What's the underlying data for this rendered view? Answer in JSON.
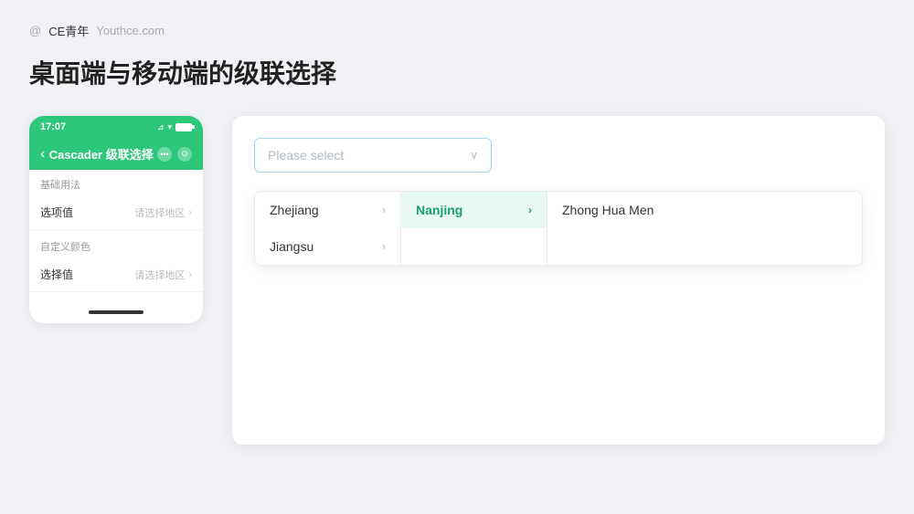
{
  "brand": {
    "at_symbol": "@",
    "name": "CE青年",
    "url": "Youthce.com"
  },
  "page_title": "桌面端与移动端的级联选择",
  "mobile": {
    "status_bar": {
      "time": "17:07",
      "signal": "⊿",
      "wifi": "▾"
    },
    "nav": {
      "back_icon": "‹",
      "title": "Cascader 级联选择",
      "action1": "•••",
      "action2": "⊙"
    },
    "section1_label": "基础用法",
    "items": [
      {
        "label": "选项值",
        "value": "请选择地区"
      },
      {
        "label": "选择值",
        "value": "请选择地区"
      }
    ],
    "section2_label": "自定义颜色",
    "home_indicator": ""
  },
  "desktop": {
    "input": {
      "placeholder": "Please select",
      "arrow": "∨"
    },
    "columns": [
      {
        "items": [
          {
            "label": "Zhejiang",
            "has_arrow": true,
            "active": false
          },
          {
            "label": "Jiangsu",
            "has_arrow": true,
            "active": false
          }
        ]
      },
      {
        "items": [
          {
            "label": "Nanjing",
            "has_arrow": true,
            "active": true
          }
        ]
      },
      {
        "items": [
          {
            "label": "Zhong Hua Men",
            "has_arrow": false,
            "active": false
          }
        ]
      }
    ]
  }
}
